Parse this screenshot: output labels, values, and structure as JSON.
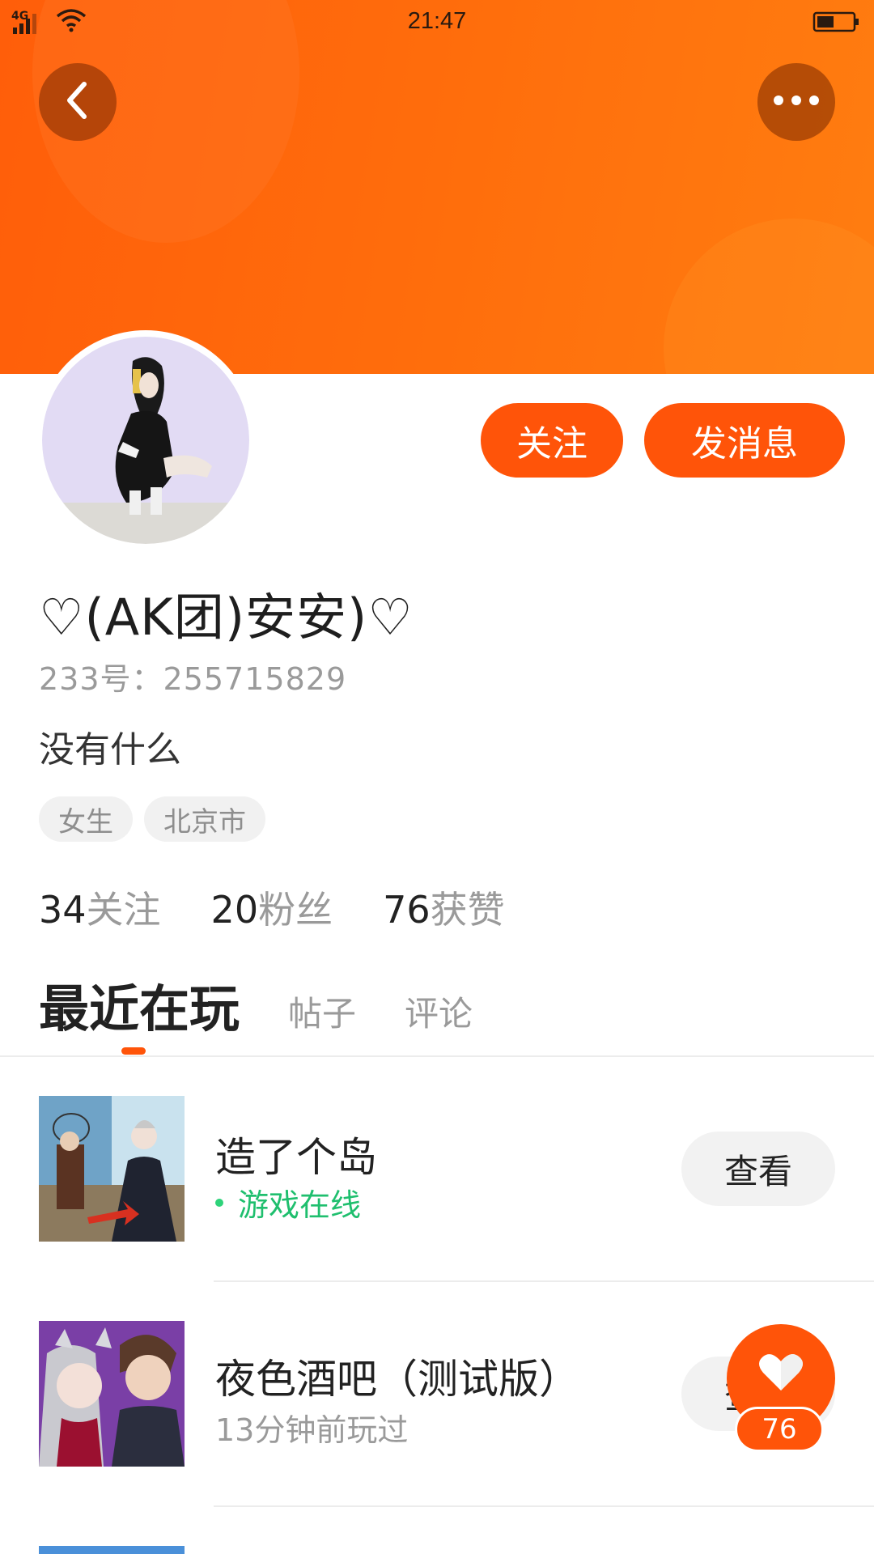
{
  "status_bar": {
    "network": "4G",
    "time": "21:47"
  },
  "header": {
    "back_icon": "chevron-left-icon",
    "more_icon": "more-dots-icon",
    "banner_color": "#ff6a0c"
  },
  "profile": {
    "nickname": "♡(AK团)安安)♡",
    "uid": "233号：255715829",
    "bio": "没有什么",
    "tags": [
      "女生",
      "北京市"
    ]
  },
  "actions": {
    "follow_label": "关注",
    "message_label": "发消息",
    "accent": "#ff5409"
  },
  "stats": [
    {
      "num": "34",
      "label": "关注"
    },
    {
      "num": "20",
      "label": "粉丝"
    },
    {
      "num": "76",
      "label": "获赞"
    }
  ],
  "tabs": [
    {
      "label": "最近在玩"
    },
    {
      "label": "帖子"
    },
    {
      "label": "评论"
    }
  ],
  "games": [
    {
      "name": "造了个岛",
      "status": "游戏在线",
      "status_color": "#1fbf6e",
      "button": "查看"
    },
    {
      "name": "夜色酒吧（测试版）",
      "status": "13分钟前玩过",
      "status_color": "#9a9a9a",
      "button": "查看"
    }
  ],
  "like_fab": {
    "icon": "heart-icon",
    "count": "76"
  }
}
